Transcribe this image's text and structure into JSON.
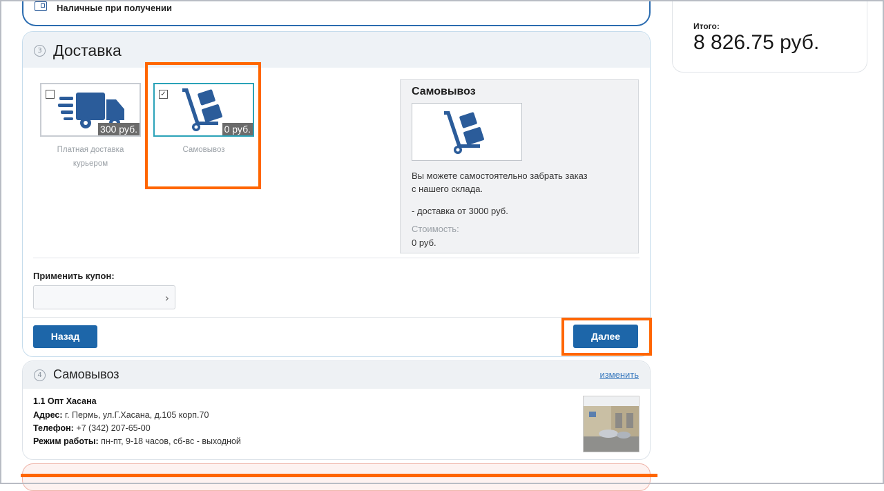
{
  "payment": {
    "label": "Наличные при получении"
  },
  "total": {
    "label": "Итого:",
    "value": "8 826.75 руб."
  },
  "delivery": {
    "step": "3",
    "title": "Доставка",
    "options": [
      {
        "name_line1": "Платная доставка",
        "name_line2": "курьером",
        "price": "300 руб.",
        "checked": false,
        "icon": "truck-icon"
      },
      {
        "name_line1": "Самовывоз",
        "name_line2": "",
        "price": "0 руб.",
        "checked": true,
        "icon": "hand-truck-icon"
      }
    ],
    "info": {
      "title": "Самовывоз",
      "desc_line1": "Вы можете самостоятельно забрать заказ",
      "desc_line2": "с нашего склада.",
      "note": "- доставка от 3000 руб.",
      "cost_label": "Стоимость:",
      "cost_value": "0 руб."
    },
    "coupon": {
      "label": "Применить купон:",
      "placeholder": ""
    },
    "back_button": "Назад",
    "next_button": "Далее"
  },
  "pickup": {
    "step": "4",
    "title": "Самовывоз",
    "change_link": "изменить",
    "store_name": "1.1 Опт Хасана",
    "address_label": "Адрес:",
    "address": "г. Пермь, ул.Г.Хасана, д.105 корп.70",
    "phone_label": "Телефон:",
    "phone": "+7 (342) 207-65-00",
    "hours_label": "Режим работы:",
    "hours": "пн-пт, 9-18 часов, сб-вс - выходной"
  },
  "colors": {
    "accent": "#1d66a9",
    "highlight": "#ff6600",
    "icon": "#2b5c9a",
    "selected_border": "#2aa2b8"
  }
}
